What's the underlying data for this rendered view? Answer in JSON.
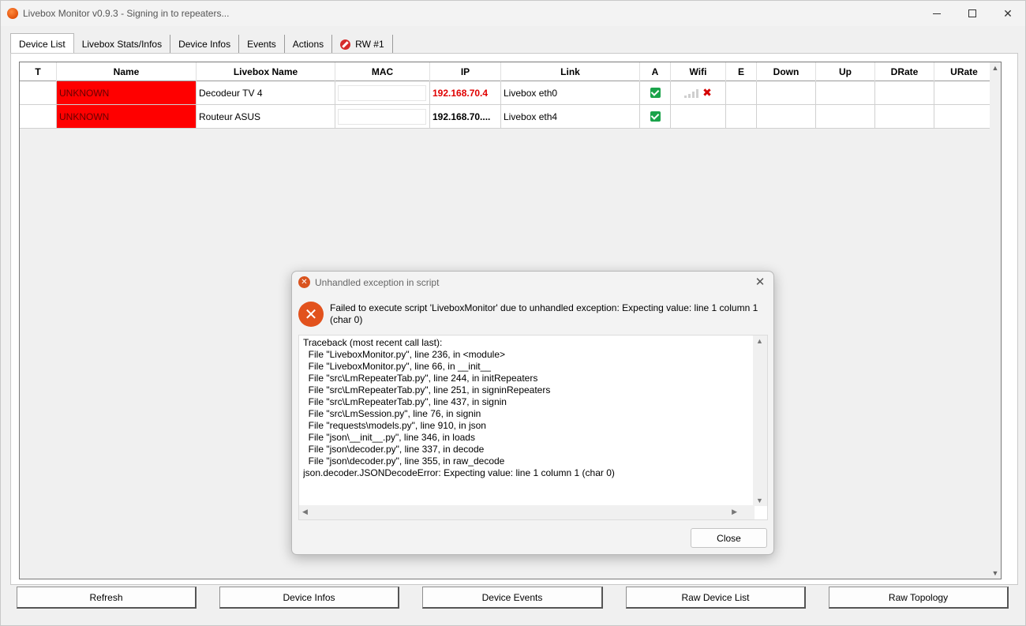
{
  "window": {
    "title": "Livebox Monitor v0.9.3 - Signing in to repeaters...",
    "app_icon": "livebox-orange-icon"
  },
  "tabs": [
    {
      "label": "Device List",
      "active": true
    },
    {
      "label": "Livebox Stats/Infos",
      "active": false
    },
    {
      "label": "Device Infos",
      "active": false
    },
    {
      "label": "Events",
      "active": false
    },
    {
      "label": "Actions",
      "active": false
    },
    {
      "label": "RW #1",
      "active": false,
      "icon": "no-entry-icon"
    }
  ],
  "grid": {
    "columns": [
      "T",
      "Name",
      "Livebox Name",
      "MAC",
      "IP",
      "Link",
      "A",
      "Wifi",
      "E",
      "Down",
      "Up",
      "DRate",
      "URate"
    ],
    "rows": [
      {
        "t": "",
        "name": "UNKNOWN",
        "livebox_name": "Decodeur TV 4",
        "mac": "",
        "ip": "192.168.70.4",
        "link": "Livebox eth0",
        "active": true,
        "wifi_status": "disconnected"
      },
      {
        "t": "",
        "name": "UNKNOWN",
        "livebox_name": "Routeur ASUS",
        "mac": "",
        "ip": "192.168.70....",
        "link": "Livebox eth4",
        "active": true,
        "wifi_status": ""
      }
    ],
    "colors": {
      "unknown_bg": "#ff0000",
      "ip_red": "#e00000",
      "active_green": "#1aa34a"
    }
  },
  "buttons": {
    "refresh": "Refresh",
    "device_infos": "Device Infos",
    "device_events": "Device Events",
    "raw_device_list": "Raw Device List",
    "raw_topology": "Raw Topology"
  },
  "dialog": {
    "title": "Unhandled exception in script",
    "message": "Failed to execute script 'LiveboxMonitor' due to unhandled exception: Expecting value: line 1 column 1 (char 0)",
    "traceback": "Traceback (most recent call last):\n  File \"LiveboxMonitor.py\", line 236, in <module>\n  File \"LiveboxMonitor.py\", line 66, in __init__\n  File \"src\\LmRepeaterTab.py\", line 244, in initRepeaters\n  File \"src\\LmRepeaterTab.py\", line 251, in signinRepeaters\n  File \"src\\LmRepeaterTab.py\", line 437, in signin\n  File \"src\\LmSession.py\", line 76, in signin\n  File \"requests\\models.py\", line 910, in json\n  File \"json\\__init__.py\", line 346, in loads\n  File \"json\\decoder.py\", line 337, in decode\n  File \"json\\decoder.py\", line 355, in raw_decode\njson.decoder.JSONDecodeError: Expecting value: line 1 column 1 (char 0)",
    "close_label": "Close",
    "icon": "error-icon"
  }
}
